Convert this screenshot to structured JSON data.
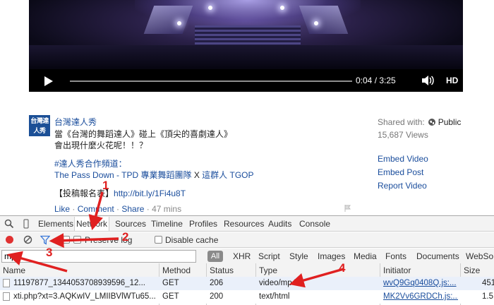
{
  "video": {
    "time_display": "0:04 / 3:25",
    "hd_label": "HD"
  },
  "post": {
    "avatar_text": "台灣達人秀",
    "channel_name": "台灣達人秀",
    "line1": "當《台灣的舞蹈達人》碰上《頂尖的喜劇達人》",
    "line2": "會出現什麼火花呢！！？",
    "hashtag": "#達人秀合作頻道：",
    "link_group": "The Pass Down - TPD 專業舞蹈團隊",
    "x_sep": " X ",
    "link_partner": "這群人 TGOP",
    "submit_label": "【投稿報名表】",
    "submit_url": "http://bit.ly/1Fi4u8T",
    "like": "Like",
    "comment": "Comment",
    "share": "Share",
    "age": "47 mins",
    "sep": " · "
  },
  "sidebar": {
    "shared_with_label": "Shared with:",
    "shared_with_value": "Public",
    "views": "15,687 Views",
    "links": [
      "Embed Video",
      "Embed Post",
      "Report Video"
    ]
  },
  "devtools": {
    "tabs": [
      "Elements",
      "Network",
      "Sources",
      "Timeline",
      "Profiles",
      "Resources",
      "Audits",
      "Console"
    ],
    "active_tab": "Network",
    "preserve_log": "Preserve log",
    "disable_cache": "Disable cache",
    "filter_value": "mp4",
    "filter_types": [
      "All",
      "XHR",
      "Script",
      "Style",
      "Images",
      "Media",
      "Fonts",
      "Documents",
      "WebSo"
    ],
    "columns": [
      "Name",
      "Method",
      "Status",
      "Type",
      "Initiator",
      "Size"
    ],
    "rows": [
      {
        "name": "11197877_1344053708939596_12...",
        "method": "GET",
        "status": "206",
        "type": "video/mp4",
        "initiator": "wvQ9Gq0408Q.js:...",
        "size": "451"
      },
      {
        "name": "xti.php?xt=3.AQKwIV_LMIIBVlWTu65...",
        "method": "GET",
        "status": "200",
        "type": "text/html",
        "initiator": "MK2Vv6GRDCh.js:...",
        "size": "1.5"
      }
    ]
  },
  "annotations": [
    "1",
    "2",
    "3",
    "4"
  ],
  "colors": {
    "accent_link": "#1a4d9c",
    "annotation_red": "#e02020",
    "record_red": "#e03131",
    "selected_row": "#eaf0fa"
  }
}
